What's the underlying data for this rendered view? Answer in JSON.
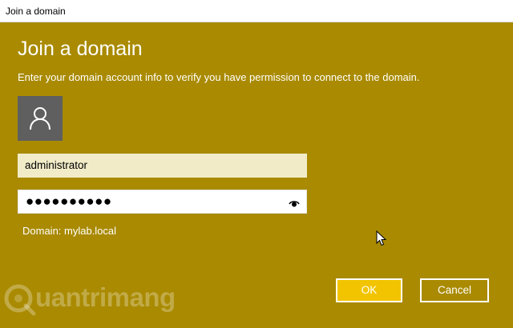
{
  "window": {
    "title": "Join a domain"
  },
  "dialog": {
    "heading": "Join a domain",
    "description": "Enter your domain account info to verify you have permission to connect to the domain.",
    "username_value": "administrator",
    "password_masked": "●●●●●●●●●●",
    "domain_label": "Domain: mylab.local"
  },
  "buttons": {
    "ok": "OK",
    "cancel": "Cancel"
  },
  "icons": {
    "avatar": "user-icon",
    "reveal": "eye-icon",
    "cursor": "mouse-pointer-icon"
  },
  "watermark": {
    "text": "uantrimang"
  },
  "colors": {
    "background": "#a98a00",
    "accent": "#f2c400"
  }
}
